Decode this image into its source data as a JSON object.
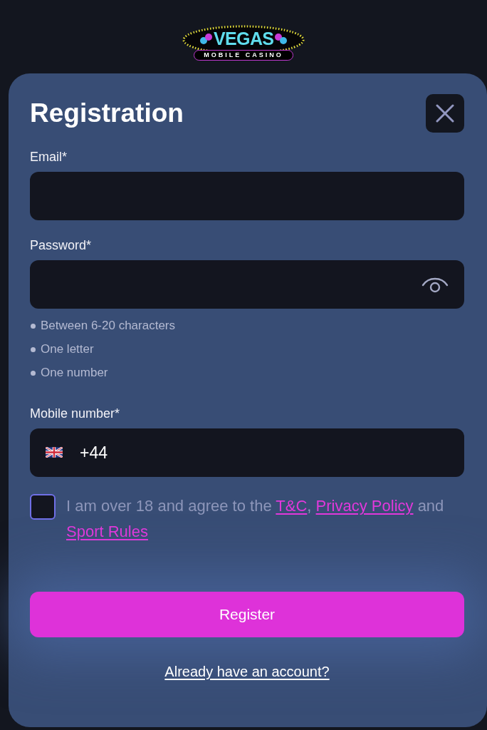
{
  "logo": {
    "title": "VEGAS",
    "subtitle": "MOBILE CASINO"
  },
  "dialog": {
    "title": "Registration",
    "fields": [
      {
        "kind": "email",
        "label": "Email*"
      },
      {
        "kind": "password",
        "label": "Password*",
        "requirements": [
          "Between 6-20 characters",
          "One letter",
          "One number"
        ]
      },
      {
        "kind": "phone",
        "label": "Mobile number*",
        "value": "+44"
      }
    ],
    "agreement": {
      "checked": false,
      "segments": [
        {
          "kind": "text",
          "text": "I am over 18 and agree to the "
        },
        {
          "kind": "link",
          "text": "T&C"
        },
        {
          "kind": "text",
          "text": ", "
        },
        {
          "kind": "link",
          "text": "Privacy Policy"
        },
        {
          "kind": "text",
          "text": " and "
        },
        {
          "kind": "link",
          "text": "Sport Rules"
        }
      ]
    },
    "submit": "Register",
    "login_link": "Already have an account?"
  }
}
